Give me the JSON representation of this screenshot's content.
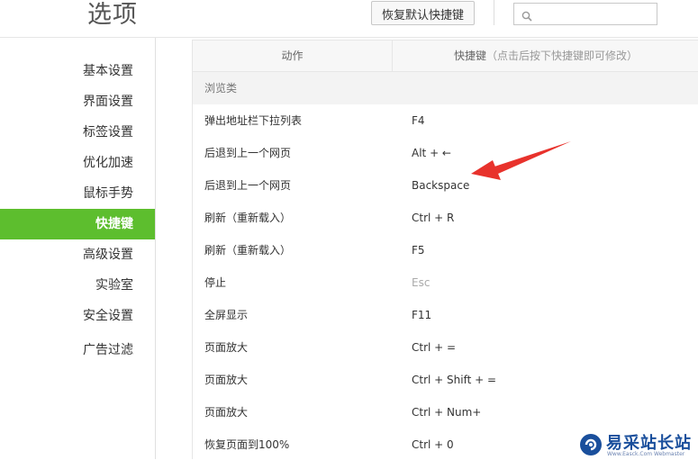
{
  "header": {
    "title": "选项",
    "reset_button": "恢复默认快捷键",
    "search_placeholder": ""
  },
  "sidebar": {
    "items": [
      {
        "label": "基本设置"
      },
      {
        "label": "界面设置"
      },
      {
        "label": "标签设置"
      },
      {
        "label": "优化加速"
      },
      {
        "label": "鼠标手势"
      },
      {
        "label": "快捷键",
        "active": true
      },
      {
        "label": "高级设置"
      },
      {
        "label": "实验室"
      },
      {
        "label": "安全设置"
      },
      {
        "label": "广告过滤"
      }
    ]
  },
  "table": {
    "col_action": "动作",
    "col_shortcut": "快捷键",
    "col_shortcut_hint": "（点击后按下快捷键即可修改）",
    "group_label": "浏览类",
    "rows": [
      {
        "action": "弹出地址栏下拉列表",
        "key": "F4"
      },
      {
        "action": "后退到上一个网页",
        "key": "Alt + ←"
      },
      {
        "action": "后退到上一个网页",
        "key": "Backspace"
      },
      {
        "action": "刷新（重新载入）",
        "key": "Ctrl + R"
      },
      {
        "action": "刷新（重新载入）",
        "key": "F5"
      },
      {
        "action": "停止",
        "key": "Esc"
      },
      {
        "action": "全屏显示",
        "key": "F11"
      },
      {
        "action": "页面放大",
        "key": "Ctrl + ="
      },
      {
        "action": "页面放大",
        "key": "Ctrl + Shift + ="
      },
      {
        "action": "页面放大",
        "key": "Ctrl + Num+"
      },
      {
        "action": "恢复页面到100%",
        "key": "Ctrl + 0"
      }
    ]
  },
  "colors": {
    "accent": "#5dbe2e",
    "annotation_arrow": "#e8322c",
    "watermark": "#1a4f9c"
  },
  "watermark": {
    "text": "易采站长站",
    "subtext": "Www.Easck.Com  Webmaster"
  }
}
